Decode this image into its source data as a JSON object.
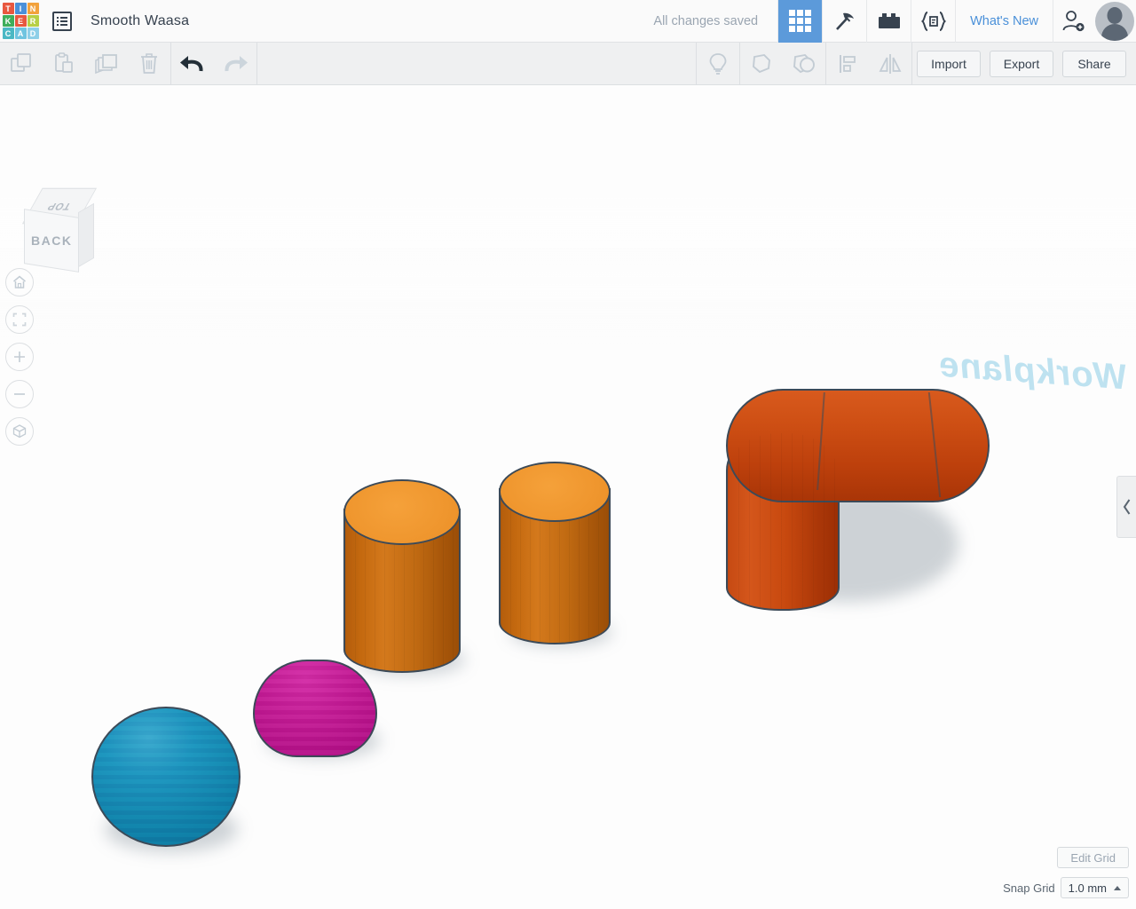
{
  "app": {
    "name": "Tinkercad",
    "logo_letters": [
      "T",
      "I",
      "N",
      "K",
      "E",
      "R",
      "C",
      "A",
      "D"
    ],
    "logo_colors": [
      "#e8573f",
      "#4a90d9",
      "#f2a23c",
      "#3fae5a",
      "#e8573f",
      "#b7cf45",
      "#4ab8c4",
      "#6fc4e0",
      "#8ecfe8"
    ]
  },
  "header": {
    "doc_icon": "document-list-icon",
    "project_title": "Smooth Waasa",
    "save_status": "All changes saved",
    "tabs": [
      {
        "name": "tab-3d-design",
        "icon": "grid-3x3-icon",
        "active": true
      },
      {
        "name": "tab-codeblocks",
        "icon": "pickaxe-icon",
        "active": false
      },
      {
        "name": "tab-bricks",
        "icon": "brick-icon",
        "active": false
      },
      {
        "name": "tab-codeblocks-braces",
        "icon": "code-braces-icon",
        "active": false
      }
    ],
    "whats_new": "What's New",
    "invite_icon": "person-add-icon",
    "avatar": "user-avatar"
  },
  "toolbar": {
    "copy_icon": "copy-icon",
    "paste_icon": "paste-icon",
    "duplicate_icon": "duplicate-icon",
    "delete_icon": "trash-icon",
    "undo_icon": "undo-arrow-icon",
    "redo_icon": "redo-arrow-icon",
    "hint_icon": "lightbulb-icon",
    "group_icon": "group-shapes-icon",
    "ungroup_icon": "ungroup-shapes-icon",
    "align_icon": "align-icon",
    "mirror_icon": "mirror-icon",
    "import_label": "Import",
    "export_label": "Export",
    "share_label": "Share"
  },
  "viewcube": {
    "top_face": "TOP",
    "front_face": "BACK"
  },
  "nav_buttons": [
    {
      "name": "home-view-button",
      "icon": "home-icon"
    },
    {
      "name": "fit-to-view-button",
      "icon": "fit-frame-icon"
    },
    {
      "name": "zoom-in-button",
      "icon": "plus-icon"
    },
    {
      "name": "zoom-out-button",
      "icon": "minus-icon"
    },
    {
      "name": "perspective-toggle-button",
      "icon": "cube-perspective-icon"
    }
  ],
  "canvas": {
    "watermark": "Workplane",
    "panel_handle_icon": "chevron-left-icon",
    "shapes": [
      {
        "name": "sphere-blue",
        "kind": "sphere",
        "color": "#1d93bd"
      },
      {
        "name": "dome-magenta",
        "kind": "half-sphere",
        "color": "#c41a95"
      },
      {
        "name": "cylinder-left",
        "kind": "cylinder",
        "color": "#ef962e"
      },
      {
        "name": "cylinder-right",
        "kind": "cylinder",
        "color": "#ef962e"
      },
      {
        "name": "pipe-elbow",
        "kind": "bent-pipe",
        "color": "#ce4f14"
      }
    ]
  },
  "grid_controls": {
    "edit_grid_label": "Edit Grid",
    "snap_grid_label": "Snap Grid",
    "snap_grid_value": "1.0 mm",
    "caret_icon": "caret-up-icon"
  }
}
